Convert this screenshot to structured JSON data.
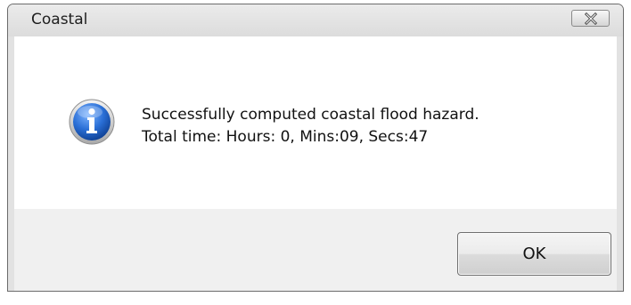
{
  "window": {
    "title": "Coastal"
  },
  "titlebar": {
    "close_icon": "close-icon"
  },
  "dialog": {
    "icon": "info-icon",
    "message_lines": [
      "Successfully computed coastal flood hazard.",
      "Total time:  Hours: 0, Mins:09, Secs:47"
    ]
  },
  "buttons": {
    "ok_label": "OK"
  },
  "colors": {
    "icon_blue": "#1d5fc0",
    "window_frame": "#dcdcdc",
    "content_bg": "#ffffff",
    "footer_bg": "#f0f0f0"
  }
}
